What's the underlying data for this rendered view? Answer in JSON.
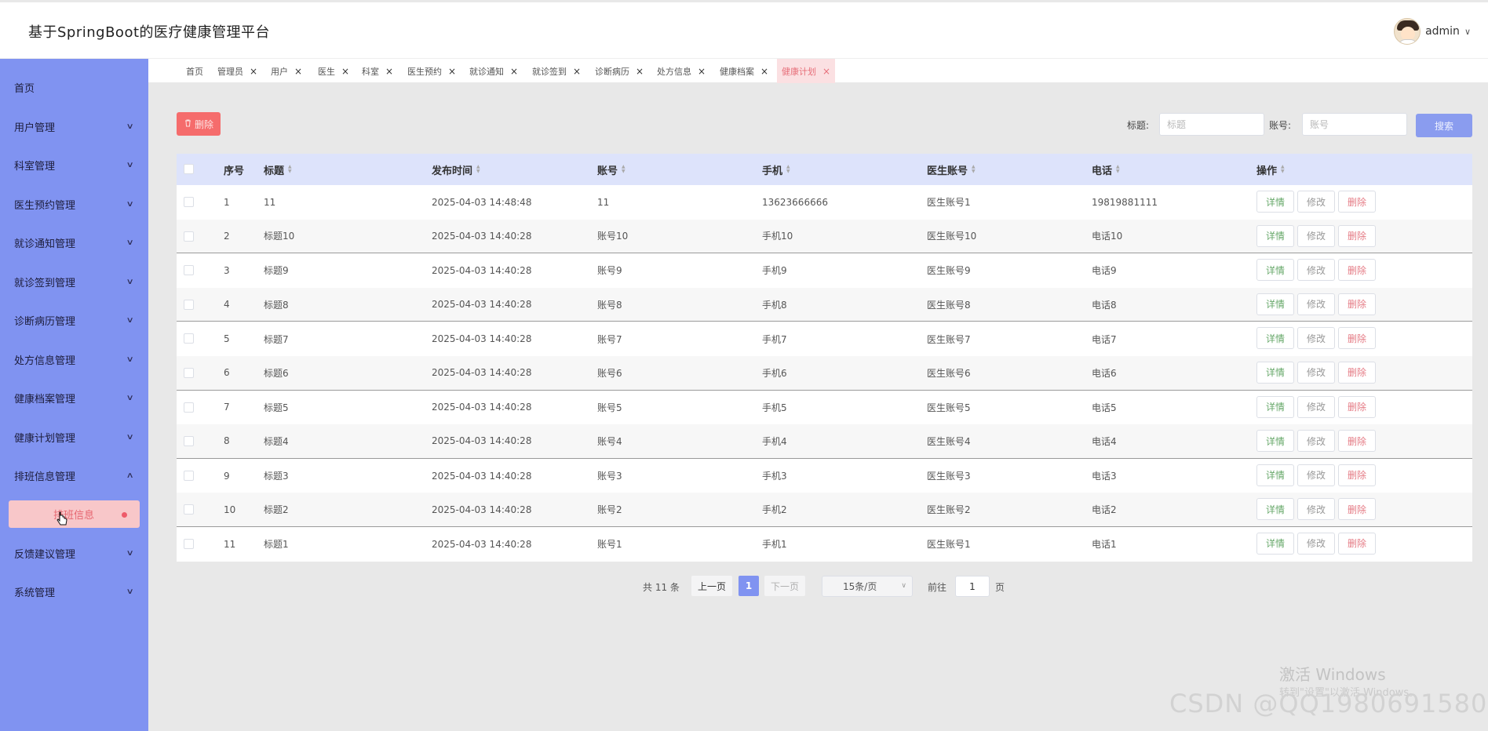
{
  "app": {
    "title": "基于SpringBoot的医疗健康管理平台"
  },
  "user": {
    "name": "admin",
    "caret": "∨"
  },
  "sidebar": {
    "items": [
      {
        "label": "首页",
        "has_chevron": false
      },
      {
        "label": "用户管理",
        "has_chevron": true,
        "chevron": "∨"
      },
      {
        "label": "科室管理",
        "has_chevron": true,
        "chevron": "∨"
      },
      {
        "label": "医生预约管理",
        "has_chevron": true,
        "chevron": "∨"
      },
      {
        "label": "就诊通知管理",
        "has_chevron": true,
        "chevron": "∨"
      },
      {
        "label": "就诊签到管理",
        "has_chevron": true,
        "chevron": "∨"
      },
      {
        "label": "诊断病历管理",
        "has_chevron": true,
        "chevron": "∨"
      },
      {
        "label": "处方信息管理",
        "has_chevron": true,
        "chevron": "∨"
      },
      {
        "label": "健康档案管理",
        "has_chevron": true,
        "chevron": "∨"
      },
      {
        "label": "健康计划管理",
        "has_chevron": true,
        "chevron": "∨"
      },
      {
        "label": "排班信息管理",
        "has_chevron": true,
        "chevron": "∧"
      },
      {
        "label": "反馈建议管理",
        "has_chevron": true,
        "chevron": "∨"
      },
      {
        "label": "系统管理",
        "has_chevron": true,
        "chevron": "∨"
      }
    ],
    "active_sub": {
      "label": "排班信息"
    }
  },
  "tabs": [
    {
      "label": "首页",
      "closable": false
    },
    {
      "label": "管理员",
      "closable": true
    },
    {
      "label": "用户",
      "closable": true
    },
    {
      "label": "医生",
      "closable": true
    },
    {
      "label": "科室",
      "closable": true
    },
    {
      "label": "医生预约",
      "closable": true
    },
    {
      "label": "就诊通知",
      "closable": true
    },
    {
      "label": "就诊签到",
      "closable": true
    },
    {
      "label": "诊断病历",
      "closable": true
    },
    {
      "label": "处方信息",
      "closable": true
    },
    {
      "label": "健康档案",
      "closable": true
    },
    {
      "label": "健康计划",
      "closable": true,
      "active": true
    }
  ],
  "tab_close_glyph": "×",
  "toolbar": {
    "delete_icon": "trash-icon",
    "delete_label": "删除",
    "search_title_label": "标题:",
    "search_title_placeholder": "标题",
    "search_account_label": "账号:",
    "search_account_placeholder": "账号",
    "search_button": "搜索"
  },
  "table": {
    "columns": [
      "序号",
      "标题",
      "发布时间",
      "账号",
      "手机",
      "医生账号",
      "电话",
      "操作"
    ],
    "sortable": [
      false,
      true,
      true,
      true,
      true,
      true,
      true,
      true
    ],
    "rows": [
      [
        "1",
        "11",
        "2025-04-03 14:48:48",
        "11",
        "13623666666",
        "医生账号1",
        "19819881111"
      ],
      [
        "2",
        "标题10",
        "2025-04-03 14:40:28",
        "账号10",
        "手机10",
        "医生账号10",
        "电话10"
      ],
      [
        "3",
        "标题9",
        "2025-04-03 14:40:28",
        "账号9",
        "手机9",
        "医生账号9",
        "电话9"
      ],
      [
        "4",
        "标题8",
        "2025-04-03 14:40:28",
        "账号8",
        "手机8",
        "医生账号8",
        "电话8"
      ],
      [
        "5",
        "标题7",
        "2025-04-03 14:40:28",
        "账号7",
        "手机7",
        "医生账号7",
        "电话7"
      ],
      [
        "6",
        "标题6",
        "2025-04-03 14:40:28",
        "账号6",
        "手机6",
        "医生账号6",
        "电话6"
      ],
      [
        "7",
        "标题5",
        "2025-04-03 14:40:28",
        "账号5",
        "手机5",
        "医生账号5",
        "电话5"
      ],
      [
        "8",
        "标题4",
        "2025-04-03 14:40:28",
        "账号4",
        "手机4",
        "医生账号4",
        "电话4"
      ],
      [
        "9",
        "标题3",
        "2025-04-03 14:40:28",
        "账号3",
        "手机3",
        "医生账号3",
        "电话3"
      ],
      [
        "10",
        "标题2",
        "2025-04-03 14:40:28",
        "账号2",
        "手机2",
        "医生账号2",
        "电话2"
      ],
      [
        "11",
        "标题1",
        "2025-04-03 14:40:28",
        "账号1",
        "手机1",
        "医生账号1",
        "电话1"
      ]
    ],
    "actions": {
      "detail": "详情",
      "edit": "修改",
      "delete": "删除"
    }
  },
  "pagination": {
    "total_text": "共 11 条",
    "prev": "上一页",
    "current_page": "1",
    "next": "下一页",
    "page_size": "15条/页",
    "goto_label": "前往",
    "goto_value": "1",
    "goto_unit": "页"
  },
  "watermarks": {
    "windows_title": "激活 Windows",
    "windows_sub": "转到\"设置\"以激活 Windows。",
    "csdn": "CSDN @QQ1980691580"
  },
  "colors": {
    "sidebar_bg": "#8093f1",
    "accent": "#8093f1",
    "danger": "#f56c6c",
    "active_tab_bg": "#fbe0e2",
    "table_header_bg": "#dde3fb"
  }
}
